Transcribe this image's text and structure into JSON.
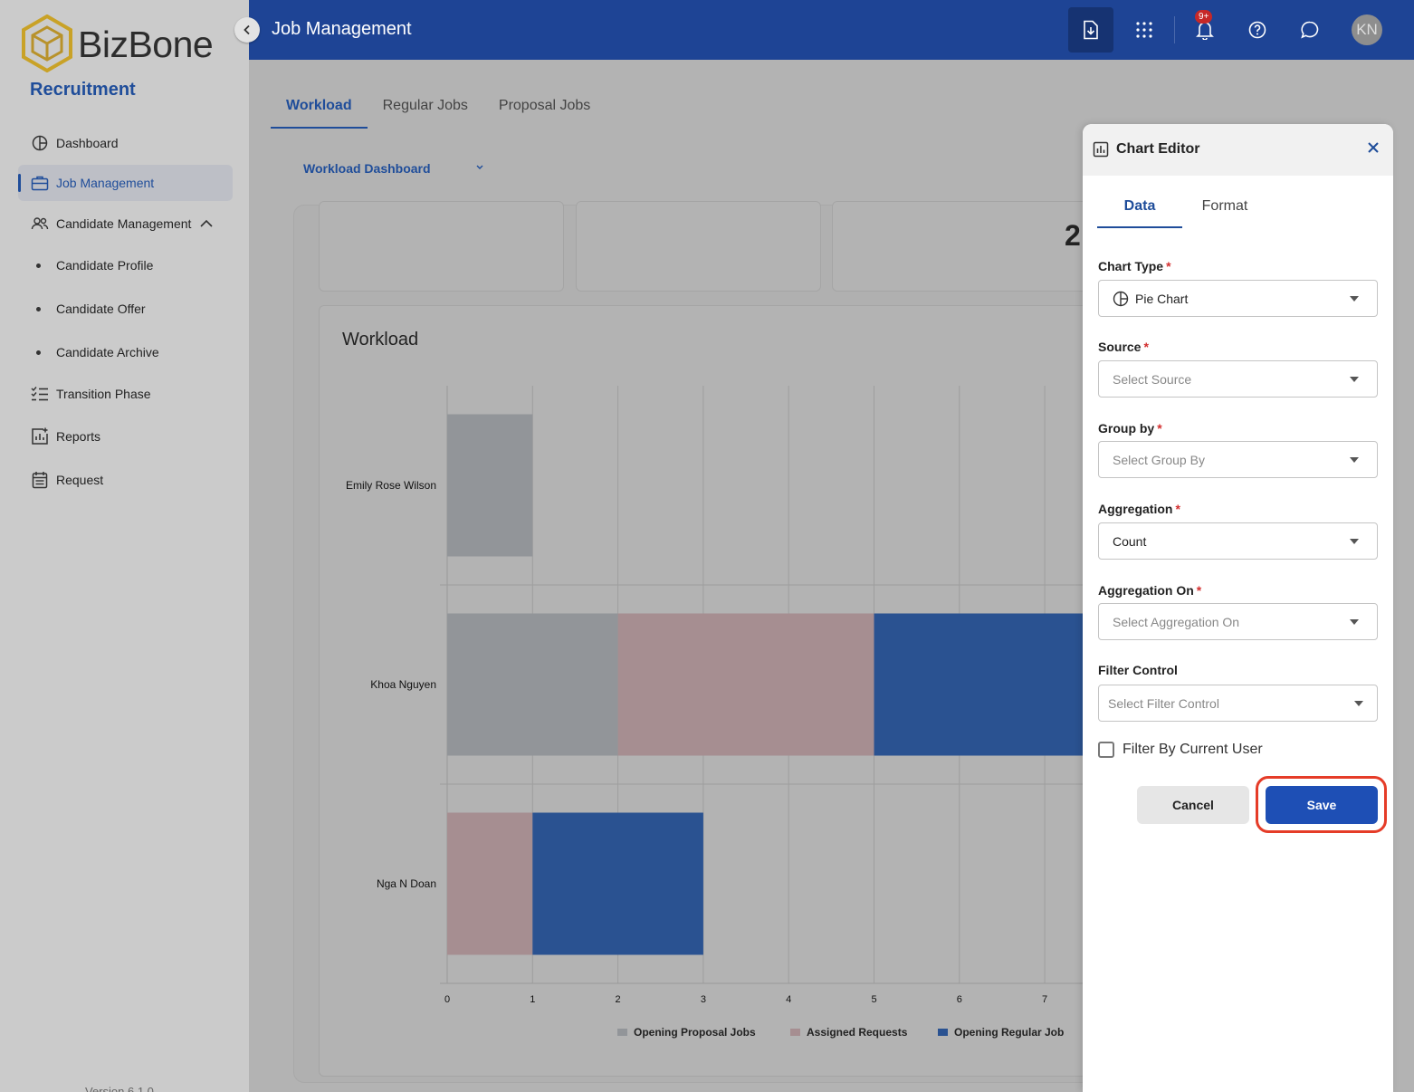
{
  "sidebar": {
    "logo_text": "BizBone",
    "app_title": "Recruitment",
    "items": [
      {
        "label": "Dashboard",
        "icon": "pie-chart-icon"
      },
      {
        "label": "Job Management",
        "icon": "briefcase-icon"
      },
      {
        "label": "Candidate Management",
        "icon": "users-icon"
      },
      {
        "label": "Transition Phase",
        "icon": "checklist-icon"
      },
      {
        "label": "Reports",
        "icon": "report-chart-icon"
      },
      {
        "label": "Request",
        "icon": "calendar-list-icon"
      }
    ],
    "sub_items": [
      {
        "label": "Candidate Profile"
      },
      {
        "label": "Candidate Offer"
      },
      {
        "label": "Candidate Archive"
      }
    ],
    "version": "Version 6.1.0"
  },
  "header": {
    "title": "Job Management",
    "notification_badge": "9+",
    "avatar_initials": "KN"
  },
  "main": {
    "tabs": [
      {
        "label": "Workload"
      },
      {
        "label": "Regular Jobs"
      },
      {
        "label": "Proposal Jobs"
      }
    ],
    "dashboard_select": "Workload Dashboard",
    "top_card_value": "2"
  },
  "chart_data": {
    "type": "bar",
    "orientation": "horizontal",
    "stacked": true,
    "title": "Workload",
    "categories": [
      "Emily Rose Wilson",
      "Khoa Nguyen",
      "Nga N Doan"
    ],
    "series": [
      {
        "name": "Opening Proposal Jobs",
        "color": "#929599",
        "values": [
          1,
          2,
          0
        ]
      },
      {
        "name": "Assigned Requests",
        "color": "#a68e91",
        "values": [
          0,
          3,
          1
        ]
      },
      {
        "name": "Opening Regular Job",
        "color": "#2a5291",
        "values": [
          0,
          3,
          2
        ]
      }
    ],
    "xticks": [
      "0",
      "1",
      "2",
      "3",
      "4",
      "5",
      "6",
      "7"
    ],
    "xlim": [
      0,
      7
    ],
    "grid": true,
    "legend_position": "bottom"
  },
  "panel": {
    "title": "Chart Editor",
    "tabs": [
      {
        "label": "Data"
      },
      {
        "label": "Format"
      }
    ],
    "fields": {
      "chart_type": {
        "label": "Chart Type",
        "value": "Pie Chart"
      },
      "source": {
        "label": "Source",
        "placeholder": "Select Source"
      },
      "group_by": {
        "label": "Group by",
        "placeholder": "Select Group By"
      },
      "aggregation": {
        "label": "Aggregation",
        "value": "Count"
      },
      "aggregation_on": {
        "label": "Aggregation On",
        "placeholder": "Select Aggregation On"
      },
      "filter_control": {
        "label": "Filter Control",
        "placeholder": "Select Filter Control"
      }
    },
    "required_mark": "*",
    "checkbox_label": "Filter By Current User",
    "cancel_label": "Cancel",
    "save_label": "Save"
  },
  "colors": {
    "header": "#1e4495",
    "accent": "#1f4d9a",
    "save": "#1e4fb5",
    "highlight": "#e53c28"
  }
}
